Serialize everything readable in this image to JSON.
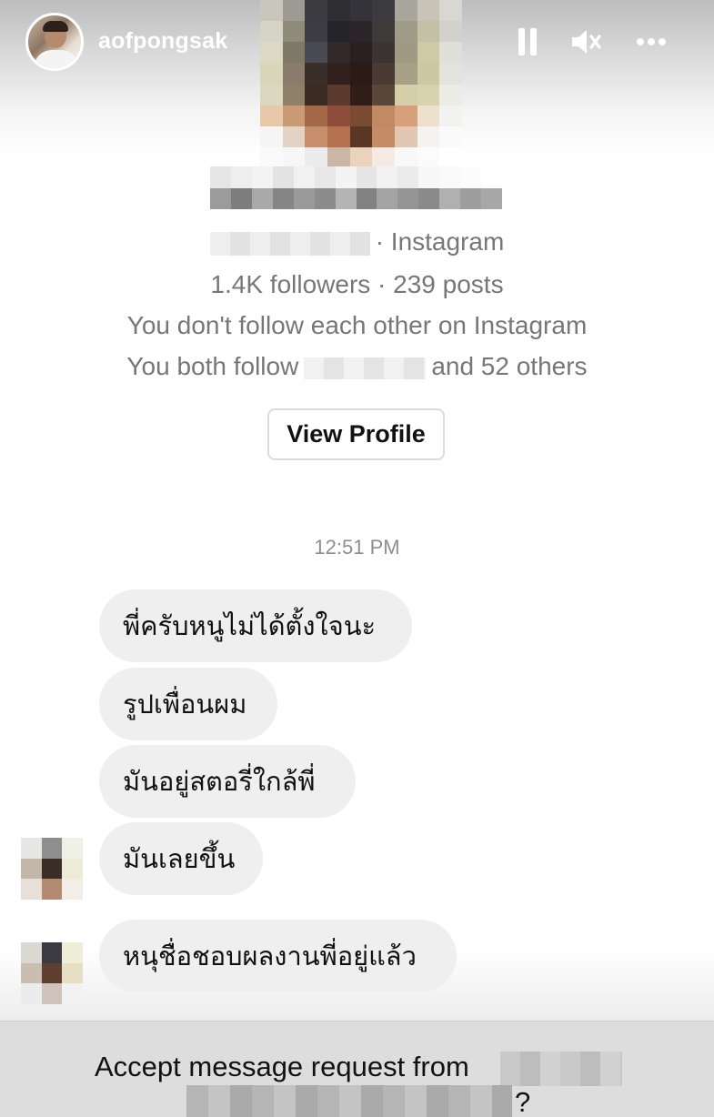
{
  "story_header": {
    "username": "aofpongsak",
    "pause_icon": "pause-icon",
    "mute_icon": "speaker-muted-icon",
    "more_icon": "more-horizontal-icon"
  },
  "profile": {
    "platform": "· Instagram",
    "stats": "1.4K followers · 239 posts",
    "follow_status": "You don't follow each other on Instagram",
    "mutual_prefix": "You both follow",
    "mutual_suffix": "and 52 others",
    "view_profile_label": "View Profile"
  },
  "chat": {
    "timestamp": "12:51 PM",
    "messages": [
      "พี่ครับหนูไม่ได้ตั้งใจนะ",
      "รูปเพื่อนผม",
      "มันอยู่สตอรี่ใกล้พี่",
      "มันเลยขึ้น",
      "หนุชื่อชอบผลงานพี่อยู่แล้ว"
    ]
  },
  "request": {
    "accept_prefix": "Accept message request from",
    "accept_suffix": "?"
  },
  "colors": {
    "bubble": "#efefef",
    "secondary_text": "#777777",
    "bottom_bar": "#dddddd"
  }
}
